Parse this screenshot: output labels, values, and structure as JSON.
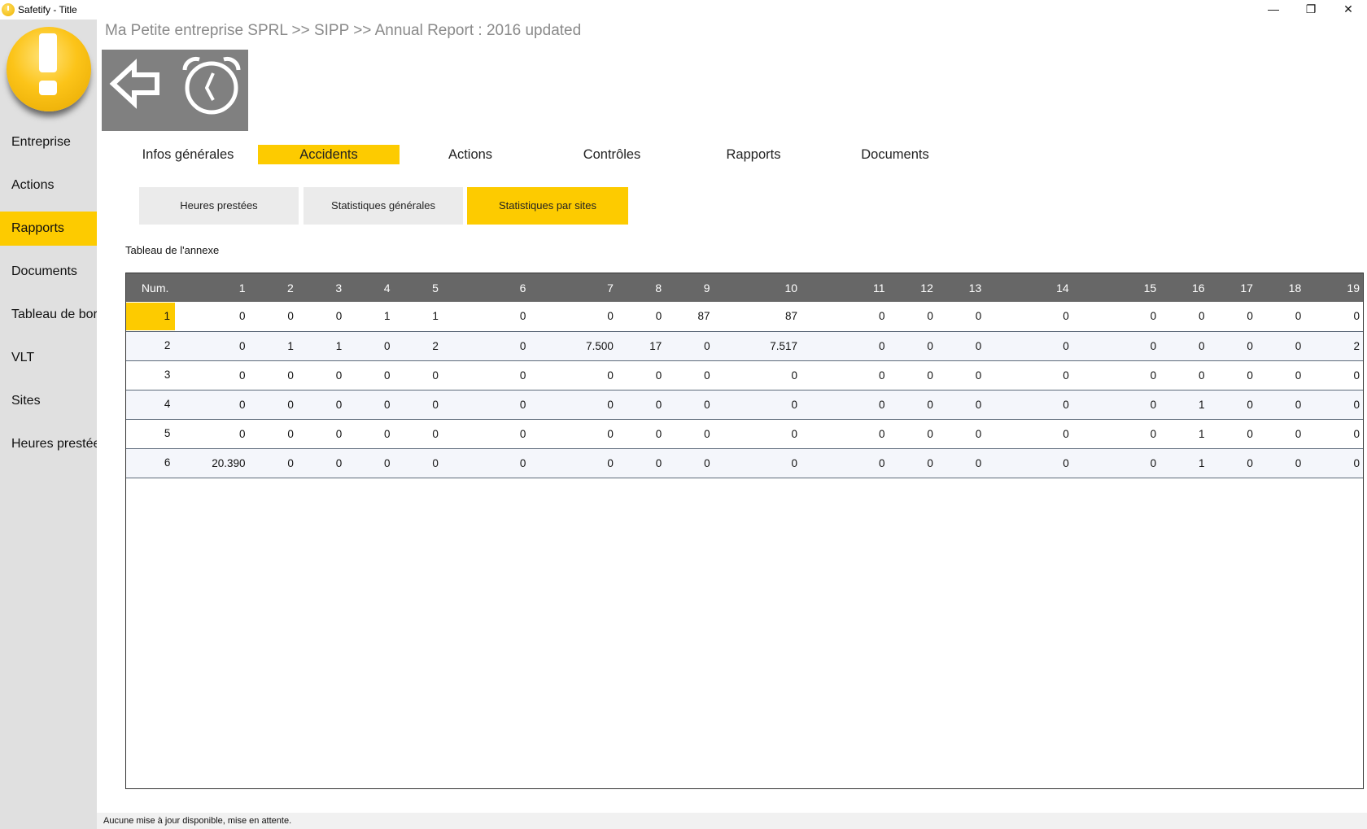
{
  "window": {
    "title": "Safetify - Title",
    "minimize_glyph": "—",
    "restore_glyph": "❐",
    "close_glyph": "✕"
  },
  "sidebar": {
    "logo_icon": "exclamation-icon",
    "items": [
      {
        "label": "Entreprise",
        "active": false
      },
      {
        "label": "Actions",
        "active": false
      },
      {
        "label": "Rapports",
        "active": true
      },
      {
        "label": "Documents",
        "active": false
      },
      {
        "label": "Tableau de bord",
        "active": false
      },
      {
        "label": "VLT",
        "active": false
      },
      {
        "label": "Sites",
        "active": false
      },
      {
        "label": "Heures prestées",
        "active": false
      }
    ]
  },
  "breadcrumb": "Ma Petite entreprise SPRL >> SIPP >> Annual Report : 2016 updated",
  "toolbar": {
    "back_icon": "back-arrow-icon",
    "timer_icon": "stopwatch-icon"
  },
  "main_tabs": [
    {
      "label": "Infos générales",
      "active": false
    },
    {
      "label": "Accidents",
      "active": true
    },
    {
      "label": "Actions",
      "active": false
    },
    {
      "label": "Contrôles",
      "active": false
    },
    {
      "label": "Rapports",
      "active": false
    },
    {
      "label": "Documents",
      "active": false
    }
  ],
  "sub_tabs": [
    {
      "label": "Heures prestées",
      "active": false
    },
    {
      "label": "Statistiques générales",
      "active": false
    },
    {
      "label": "Statistiques par sites",
      "active": true
    }
  ],
  "section_label": "Tableau de l'annexe",
  "table": {
    "headers": [
      "Num.",
      "1",
      "2",
      "3",
      "4",
      "5",
      "6",
      "7",
      "8",
      "9",
      "10",
      "11",
      "12",
      "13",
      "14",
      "15",
      "16",
      "17",
      "18",
      "19"
    ],
    "rows": [
      [
        "1",
        "0",
        "0",
        "0",
        "1",
        "1",
        "0",
        "0",
        "0",
        "87",
        "87",
        "0",
        "0",
        "0",
        "0",
        "0",
        "0",
        "0",
        "0",
        "0"
      ],
      [
        "2",
        "0",
        "1",
        "1",
        "0",
        "2",
        "0",
        "7.500",
        "17",
        "0",
        "7.517",
        "0",
        "0",
        "0",
        "0",
        "0",
        "0",
        "0",
        "0",
        "2"
      ],
      [
        "3",
        "0",
        "0",
        "0",
        "0",
        "0",
        "0",
        "0",
        "0",
        "0",
        "0",
        "0",
        "0",
        "0",
        "0",
        "0",
        "0",
        "0",
        "0",
        "0"
      ],
      [
        "4",
        "0",
        "0",
        "0",
        "0",
        "0",
        "0",
        "0",
        "0",
        "0",
        "0",
        "0",
        "0",
        "0",
        "0",
        "0",
        "1",
        "0",
        "0",
        "0"
      ],
      [
        "5",
        "0",
        "0",
        "0",
        "0",
        "0",
        "0",
        "0",
        "0",
        "0",
        "0",
        "0",
        "0",
        "0",
        "0",
        "0",
        "1",
        "0",
        "0",
        "0"
      ],
      [
        "6",
        "20.390",
        "0",
        "0",
        "0",
        "0",
        "0",
        "0",
        "0",
        "0",
        "0",
        "0",
        "0",
        "0",
        "0",
        "0",
        "1",
        "0",
        "0",
        "0"
      ]
    ],
    "selected_row": 0
  },
  "status_text": "Aucune mise à jour disponible, mise en attente.",
  "colors": {
    "accent": "#fdcb00",
    "sidebar_bg": "#e0e0e0",
    "table_header_bg": "#676767",
    "toolbar_bg": "#808080"
  }
}
